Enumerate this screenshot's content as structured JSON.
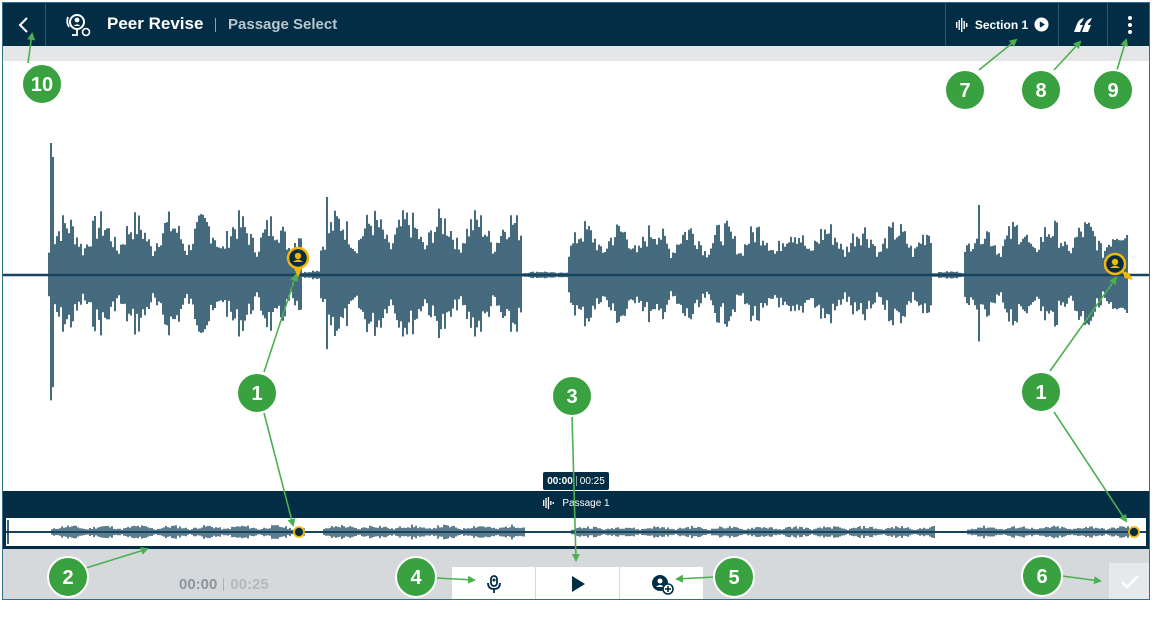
{
  "header": {
    "title": "Peer Revise",
    "subtitle": "Passage Select",
    "section_label": "Section 1"
  },
  "tooltip": {
    "current": "00:00",
    "total": "00:25"
  },
  "passage": {
    "label": "Passage 1"
  },
  "playback": {
    "current": "00:00",
    "total": "00:25"
  },
  "callouts": [
    "1",
    "1",
    "2",
    "3",
    "4",
    "5",
    "6",
    "7",
    "8",
    "9",
    "10"
  ],
  "colors": {
    "topbar": "#032d45",
    "waveform": "#17455e",
    "marker": "#f2b705",
    "callout": "#3aa140",
    "arrow": "#4cb050"
  },
  "icons": [
    "chevron-left-icon",
    "peer-revise-icon",
    "waveform-icon",
    "play-circle-icon",
    "quote-tool-icon",
    "kebab-menu-icon",
    "microphone-icon",
    "play-icon",
    "add-comment-icon",
    "checkmark-icon",
    "marker-pin-icon"
  ]
}
